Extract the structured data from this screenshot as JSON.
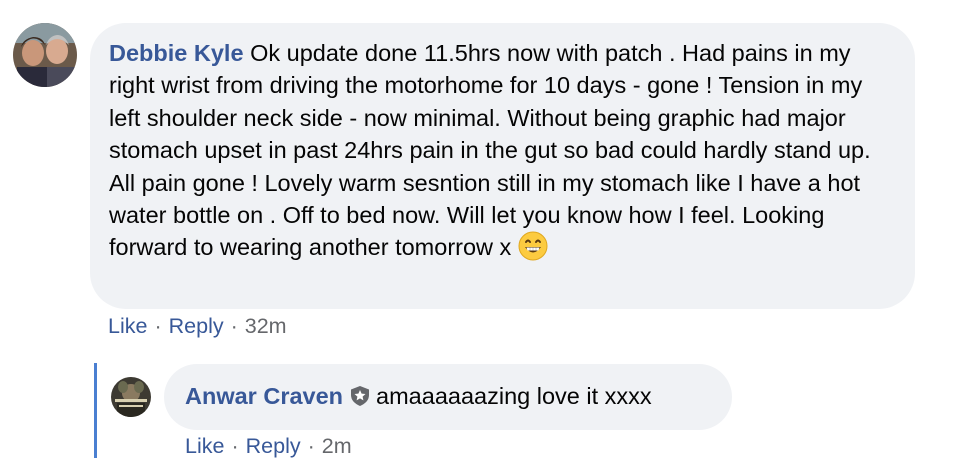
{
  "comment": {
    "author": "Debbie Kyle",
    "text": "Ok update done 11.5hrs now with patch . Had pains in my right wrist from driving the motorhome for 10 days - gone ! Tension in my left shoulder neck side - now minimal. Without being graphic had major stomach upset in past 24hrs pain in the gut so bad could hardly stand up. All pain gone ! Lovely warm sesntion still in my stomach like I have a hot water bottle on . Off to bed now. Will let you know how I feel. Looking forward to wearing another tomorrow x",
    "emoji_icon": "grinning-face-emoji",
    "actions": {
      "like": "Like",
      "reply": "Reply",
      "separator": "·",
      "time": "32m"
    }
  },
  "reply": {
    "author": "Anwar Craven",
    "badge_icon": "shield-badge-icon",
    "text": "amaaaaaazing love it xxxx",
    "actions": {
      "like": "Like",
      "reply": "Reply",
      "separator": "·",
      "time": "2m"
    }
  },
  "colors": {
    "author_link": "#385898",
    "bubble_bg": "#f0f2f5",
    "meta_text": "#65676b",
    "thread_line": "#4a7fd1"
  }
}
